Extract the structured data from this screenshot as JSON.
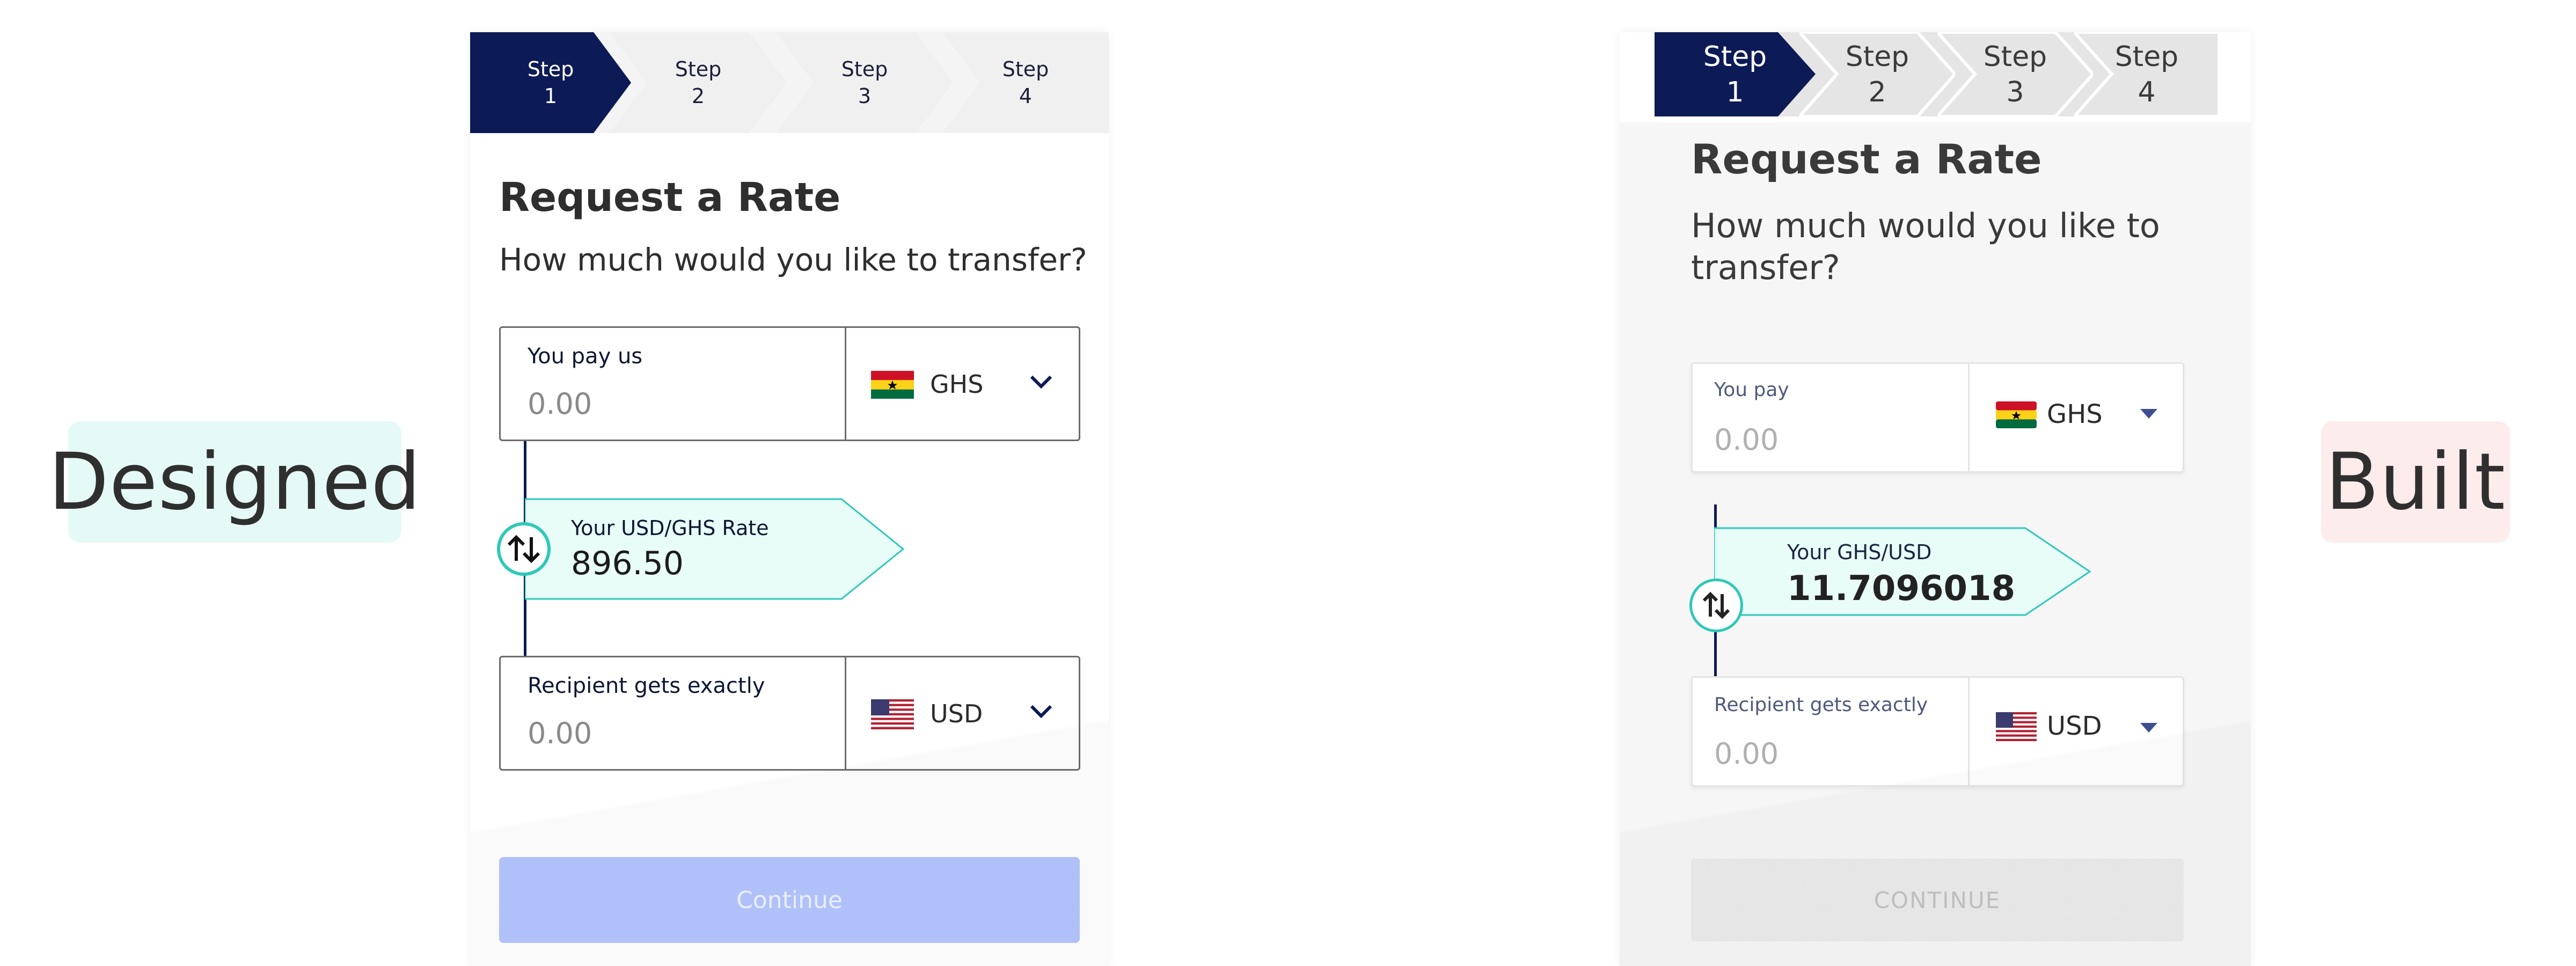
{
  "labels": {
    "designed": "Designed",
    "built": "Built"
  },
  "designed": {
    "steps": [
      {
        "line1": "Step",
        "line2": "1"
      },
      {
        "line1": "Step",
        "line2": "2"
      },
      {
        "line1": "Step",
        "line2": "3"
      },
      {
        "line1": "Step",
        "line2": "4"
      }
    ],
    "title": "Request a Rate",
    "subtitle": "How much would you like to transfer?",
    "pay": {
      "label": "You pay us",
      "placeholder": "0.00",
      "currency": "GHS"
    },
    "rate": {
      "label": "Your USD/GHS Rate",
      "value": "896.50"
    },
    "receive": {
      "label": "Recipient gets exactly",
      "placeholder": "0.00",
      "currency": "USD"
    },
    "continue": "Continue"
  },
  "built": {
    "steps": [
      {
        "line1": "Step",
        "line2": "1"
      },
      {
        "line1": "Step",
        "line2": "2"
      },
      {
        "line1": "Step",
        "line2": "3"
      },
      {
        "line1": "Step",
        "line2": "4"
      }
    ],
    "title": "Request a Rate",
    "subtitle_line1": "How much would you like to",
    "subtitle_line2": "transfer?",
    "pay": {
      "label": "You pay",
      "placeholder": "0.00",
      "currency": "GHS"
    },
    "rate": {
      "label": "Your GHS/USD",
      "value": "11.7096018"
    },
    "receive": {
      "label": "Recipient gets exactly",
      "placeholder": "0.00",
      "currency": "USD"
    },
    "continue": "CONTINUE"
  },
  "colors": {
    "navy": "#0c1a56",
    "teal": "#2ec8b8",
    "mint": "#e8fcf8",
    "disabled_blue": "#b3c5ff"
  }
}
